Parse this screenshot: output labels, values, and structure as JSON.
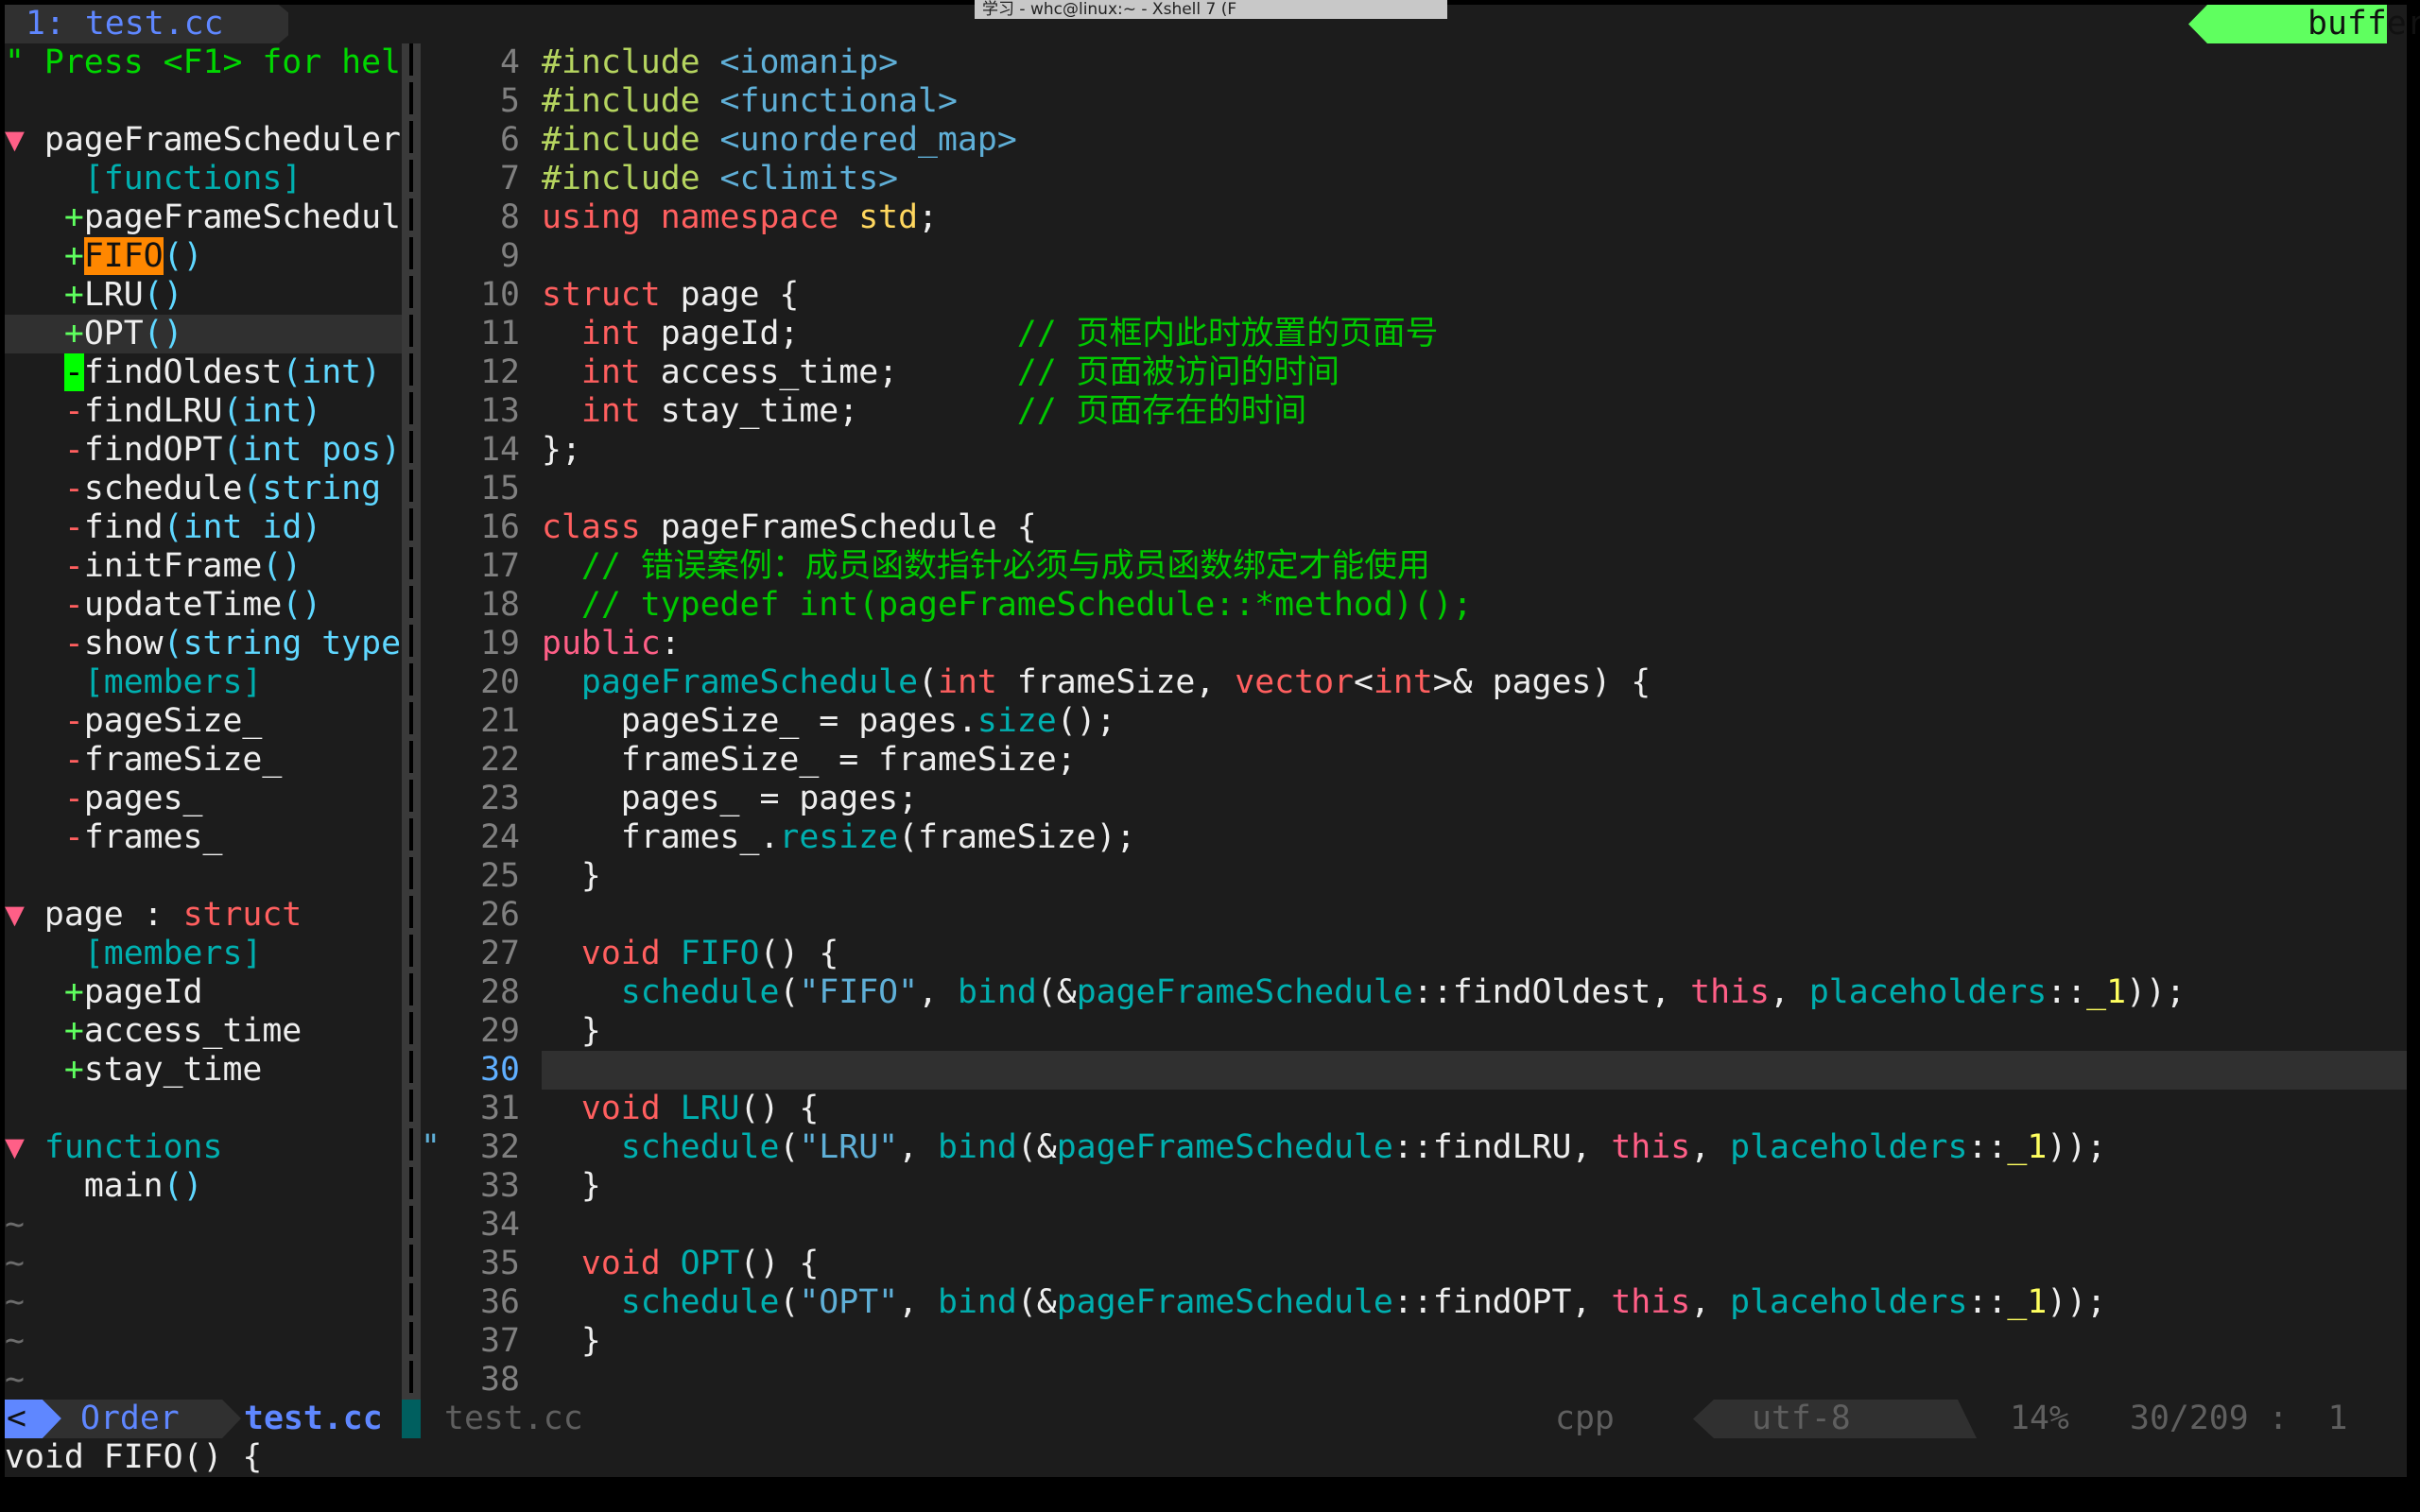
{
  "window": {
    "overlay_title": "学习 - whc@linux:~ - Xshell 7 (F"
  },
  "tabline": {
    "tab": "1: test.cc",
    "buffers_label": "buffers"
  },
  "sidebar": {
    "rows": [
      [],
      [
        [
          "\" Press <F1> for hel",
          "help"
        ]
      ],
      [],
      [
        [
          "▼ ",
          "tri"
        ],
        [
          "pageFrameScheduler",
          "plain"
        ]
      ],
      [
        [
          "    ",
          "plain"
        ],
        [
          "[functions]",
          "grp"
        ]
      ],
      [
        [
          "   ",
          "plain"
        ],
        [
          "+",
          "plus"
        ],
        [
          "pageFrameSchedul",
          "plain"
        ]
      ],
      [
        [
          "   ",
          "plain"
        ],
        [
          "+",
          "plus"
        ],
        [
          "FIFO",
          "hl"
        ],
        [
          "()",
          "typ"
        ]
      ],
      [
        [
          "   ",
          "plain"
        ],
        [
          "+",
          "plus"
        ],
        [
          "LRU",
          "plain"
        ],
        [
          "()",
          "typ"
        ]
      ],
      [
        [
          "   ",
          "plain"
        ],
        [
          "+",
          "plus"
        ],
        [
          "OPT",
          "plain"
        ],
        [
          "()",
          "typ"
        ]
      ],
      [
        [
          "   ",
          "plain"
        ],
        [
          "-",
          "curmark"
        ],
        [
          "findOldest",
          "plain"
        ],
        [
          "(int)",
          "typ"
        ]
      ],
      [
        [
          "   ",
          "plain"
        ],
        [
          "-",
          "minus"
        ],
        [
          "findLRU",
          "plain"
        ],
        [
          "(int)",
          "typ"
        ]
      ],
      [
        [
          "   ",
          "plain"
        ],
        [
          "-",
          "minus"
        ],
        [
          "findOPT",
          "plain"
        ],
        [
          "(int pos)",
          "typ"
        ]
      ],
      [
        [
          "   ",
          "plain"
        ],
        [
          "-",
          "minus"
        ],
        [
          "schedule",
          "plain"
        ],
        [
          "(string",
          "typ"
        ]
      ],
      [
        [
          "   ",
          "plain"
        ],
        [
          "-",
          "minus"
        ],
        [
          "find",
          "plain"
        ],
        [
          "(int id)",
          "typ"
        ]
      ],
      [
        [
          "   ",
          "plain"
        ],
        [
          "-",
          "minus"
        ],
        [
          "initFrame",
          "plain"
        ],
        [
          "()",
          "typ"
        ]
      ],
      [
        [
          "   ",
          "plain"
        ],
        [
          "-",
          "minus"
        ],
        [
          "updateTime",
          "plain"
        ],
        [
          "()",
          "typ"
        ]
      ],
      [
        [
          "   ",
          "plain"
        ],
        [
          "-",
          "minus"
        ],
        [
          "show",
          "plain"
        ],
        [
          "(string type",
          "typ"
        ]
      ],
      [
        [
          "    ",
          "plain"
        ],
        [
          "[members]",
          "grp"
        ]
      ],
      [
        [
          "   ",
          "plain"
        ],
        [
          "-",
          "minus"
        ],
        [
          "pageSize_",
          "plain"
        ]
      ],
      [
        [
          "   ",
          "plain"
        ],
        [
          "-",
          "minus"
        ],
        [
          "frameSize_",
          "plain"
        ]
      ],
      [
        [
          "   ",
          "plain"
        ],
        [
          "-",
          "minus"
        ],
        [
          "pages_",
          "plain"
        ]
      ],
      [
        [
          "   ",
          "plain"
        ],
        [
          "-",
          "minus"
        ],
        [
          "frames_",
          "plain"
        ]
      ],
      [],
      [
        [
          "▼ ",
          "tri"
        ],
        [
          "page : ",
          "plain"
        ],
        [
          "struct",
          "kw"
        ]
      ],
      [
        [
          "    ",
          "plain"
        ],
        [
          "[members]",
          "grp"
        ]
      ],
      [
        [
          "   ",
          "plain"
        ],
        [
          "+",
          "plus"
        ],
        [
          "pageId",
          "plain"
        ]
      ],
      [
        [
          "   ",
          "plain"
        ],
        [
          "+",
          "plus"
        ],
        [
          "access_time",
          "plain"
        ]
      ],
      [
        [
          "   ",
          "plain"
        ],
        [
          "+",
          "plus"
        ],
        [
          "stay_time",
          "plain"
        ]
      ],
      [],
      [
        [
          "▼ ",
          "tri"
        ],
        [
          "functions",
          "grp"
        ],
        [
          "          \"",
          "str"
        ]
      ],
      [
        [
          "    ",
          "plain"
        ],
        [
          "main",
          "plain"
        ],
        [
          "()",
          "typ"
        ]
      ],
      [
        [
          "~",
          "tilde"
        ]
      ],
      [
        [
          "~",
          "tilde"
        ]
      ],
      [
        [
          "~",
          "tilde"
        ]
      ],
      [
        [
          "~",
          "tilde"
        ]
      ],
      [
        [
          "~",
          "tilde"
        ]
      ]
    ]
  },
  "editor": {
    "cursor_line": "30",
    "lines": [
      {
        "n": "4",
        "t": [
          [
            "#include ",
            "pre"
          ],
          [
            "<iomanip>",
            "inc"
          ]
        ]
      },
      {
        "n": "5",
        "t": [
          [
            "#include ",
            "pre"
          ],
          [
            "<functional>",
            "inc"
          ]
        ]
      },
      {
        "n": "6",
        "t": [
          [
            "#include ",
            "pre"
          ],
          [
            "<unordered_map>",
            "inc"
          ]
        ]
      },
      {
        "n": "7",
        "t": [
          [
            "#include ",
            "pre"
          ],
          [
            "<climits>",
            "inc"
          ]
        ]
      },
      {
        "n": "8",
        "t": [
          [
            "using namespace ",
            "kw"
          ],
          [
            "std",
            "std"
          ],
          [
            ";",
            "plain"
          ]
        ]
      },
      {
        "n": "9",
        "t": []
      },
      {
        "n": "10",
        "t": [
          [
            "struct ",
            "kw"
          ],
          [
            "page {",
            "plain"
          ]
        ]
      },
      {
        "n": "11",
        "t": [
          [
            "  int ",
            "kw"
          ],
          [
            "pageId;           ",
            "plain"
          ],
          [
            "// 页框内此时放置的页面号",
            "cm"
          ]
        ]
      },
      {
        "n": "12",
        "t": [
          [
            "  int ",
            "kw"
          ],
          [
            "access_time;      ",
            "plain"
          ],
          [
            "// 页面被访问的时间",
            "cm"
          ]
        ]
      },
      {
        "n": "13",
        "t": [
          [
            "  int ",
            "kw"
          ],
          [
            "stay_time;        ",
            "plain"
          ],
          [
            "// 页面存在的时间",
            "cm"
          ]
        ]
      },
      {
        "n": "14",
        "t": [
          [
            "};",
            "plain"
          ]
        ]
      },
      {
        "n": "15",
        "t": []
      },
      {
        "n": "16",
        "t": [
          [
            "class ",
            "kw"
          ],
          [
            "pageFrameSchedule {",
            "plain"
          ]
        ]
      },
      {
        "n": "17",
        "t": [
          [
            "  // 错误案例：成员函数指针必须与成员函数绑定才能使用",
            "cm"
          ]
        ]
      },
      {
        "n": "18",
        "t": [
          [
            "  // typedef int(pageFrameSchedule::*method)();",
            "cm"
          ]
        ]
      },
      {
        "n": "19",
        "t": [
          [
            "public",
            "this"
          ],
          [
            ":",
            "plain"
          ]
        ]
      },
      {
        "n": "20",
        "t": [
          [
            "  pageFrameSchedule",
            "fn"
          ],
          [
            "(",
            "plain"
          ],
          [
            "int",
            "kw"
          ],
          [
            " frameSize, ",
            "plain"
          ],
          [
            "vector",
            "kw"
          ],
          [
            "<",
            "plain"
          ],
          [
            "int",
            "kw"
          ],
          [
            ">& pages) {",
            "plain"
          ]
        ]
      },
      {
        "n": "21",
        "t": [
          [
            "    pageSize_ = pages.",
            "plain"
          ],
          [
            "size",
            "fn"
          ],
          [
            "();",
            "plain"
          ]
        ]
      },
      {
        "n": "22",
        "t": [
          [
            "    frameSize_ = frameSize;",
            "plain"
          ]
        ]
      },
      {
        "n": "23",
        "t": [
          [
            "    pages_ = pages;",
            "plain"
          ]
        ]
      },
      {
        "n": "24",
        "t": [
          [
            "    frames_.",
            "plain"
          ],
          [
            "resize",
            "fn"
          ],
          [
            "(frameSize);",
            "plain"
          ]
        ]
      },
      {
        "n": "25",
        "t": [
          [
            "  }",
            "plain"
          ]
        ]
      },
      {
        "n": "26",
        "t": []
      },
      {
        "n": "27",
        "t": [
          [
            "  void ",
            "kw"
          ],
          [
            "FIFO",
            "fn"
          ],
          [
            "() {",
            "plain"
          ]
        ]
      },
      {
        "n": "28",
        "t": [
          [
            "    schedule",
            "fn"
          ],
          [
            "(",
            "plain"
          ],
          [
            "\"FIFO\"",
            "str"
          ],
          [
            ", ",
            "plain"
          ],
          [
            "bind",
            "fn"
          ],
          [
            "(&",
            "plain"
          ],
          [
            "pageFrameSchedule",
            "fn"
          ],
          [
            "::findOldest, ",
            "plain"
          ],
          [
            "this",
            "this"
          ],
          [
            ", ",
            "plain"
          ],
          [
            "placeholders",
            "fn"
          ],
          [
            "::",
            "plain"
          ],
          [
            "_1",
            "yel"
          ],
          [
            "));",
            "plain"
          ]
        ]
      },
      {
        "n": "29",
        "t": [
          [
            "  }",
            "plain"
          ]
        ]
      },
      {
        "n": "30",
        "t": []
      },
      {
        "n": "31",
        "t": [
          [
            "  void ",
            "kw"
          ],
          [
            "LRU",
            "fn"
          ],
          [
            "() {",
            "plain"
          ]
        ]
      },
      {
        "n": "32",
        "t": [
          [
            "    schedule",
            "fn"
          ],
          [
            "(",
            "plain"
          ],
          [
            "\"LRU\"",
            "str"
          ],
          [
            ", ",
            "plain"
          ],
          [
            "bind",
            "fn"
          ],
          [
            "(&",
            "plain"
          ],
          [
            "pageFrameSchedule",
            "fn"
          ],
          [
            "::findLRU, ",
            "plain"
          ],
          [
            "this",
            "this"
          ],
          [
            ", ",
            "plain"
          ],
          [
            "placeholders",
            "fn"
          ],
          [
            "::",
            "plain"
          ],
          [
            "_1",
            "yel"
          ],
          [
            "));",
            "plain"
          ]
        ]
      },
      {
        "n": "33",
        "t": [
          [
            "  }",
            "plain"
          ]
        ]
      },
      {
        "n": "34",
        "t": []
      },
      {
        "n": "35",
        "t": [
          [
            "  void ",
            "kw"
          ],
          [
            "OPT",
            "fn"
          ],
          [
            "() {",
            "plain"
          ]
        ]
      },
      {
        "n": "36",
        "t": [
          [
            "    schedule",
            "fn"
          ],
          [
            "(",
            "plain"
          ],
          [
            "\"OPT\"",
            "str"
          ],
          [
            ", ",
            "plain"
          ],
          [
            "bind",
            "fn"
          ],
          [
            "(&",
            "plain"
          ],
          [
            "pageFrameSchedule",
            "fn"
          ],
          [
            "::findOPT, ",
            "plain"
          ],
          [
            "this",
            "this"
          ],
          [
            ", ",
            "plain"
          ],
          [
            "placeholders",
            "fn"
          ],
          [
            "::",
            "plain"
          ],
          [
            "_1",
            "yel"
          ],
          [
            "));",
            "plain"
          ]
        ]
      },
      {
        "n": "37",
        "t": [
          [
            "  }",
            "plain"
          ]
        ]
      },
      {
        "n": "38",
        "t": []
      }
    ]
  },
  "statusline": {
    "mode": "<",
    "left_label": "Order",
    "active_file": "test.cc",
    "file": "test.cc",
    "filetype": "cpp",
    "encoding": "utf-8",
    "percent": "14%",
    "position": "30/209 :  1"
  },
  "cmdline": {
    "text": "void FIFO() {"
  },
  "colors": {
    "background": "#1c1c1c",
    "keyword": "#ff5f5f",
    "comment": "#00c800",
    "function": "#00afaf",
    "accent": "#5f87ff",
    "tag_green": "#5fff5f",
    "highlight": "#ff8700"
  }
}
